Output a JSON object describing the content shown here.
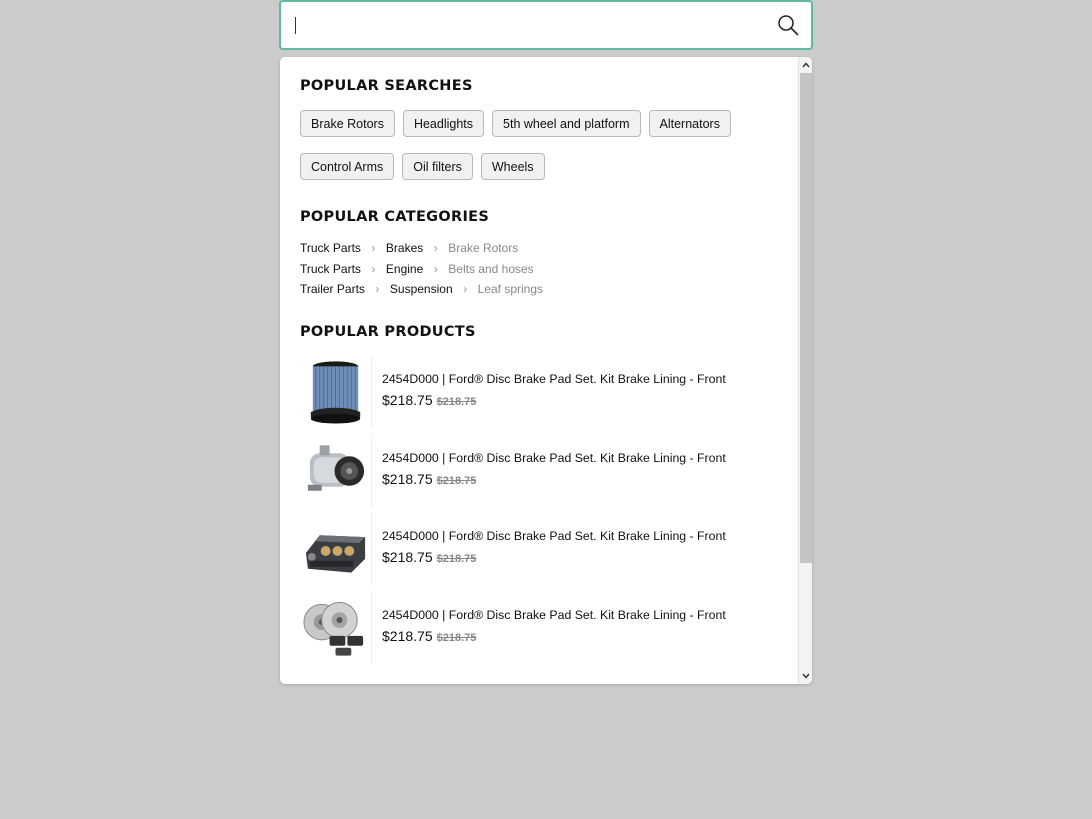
{
  "search": {
    "placeholder": "",
    "value": ""
  },
  "sections": {
    "searches_title": "POPULAR SEARCHES",
    "categories_title": "POPULAR CATEGORIES",
    "products_title": "POPULAR PRODUCTS"
  },
  "popular_searches": [
    "Brake Rotors",
    "Headlights",
    "5th wheel and platform",
    "Alternators",
    "Control Arms",
    "Oil filters",
    "Wheels"
  ],
  "categories": [
    [
      "Truck Parts",
      "Brakes",
      "Brake Rotors"
    ],
    [
      "Truck Parts",
      "Engine",
      "Belts and hoses"
    ],
    [
      "Trailer Parts",
      "Suspension",
      "Leaf springs"
    ]
  ],
  "products": [
    {
      "title": "2454D000 | Ford® Disc Brake Pad Set. Kit Brake Lining - Front",
      "price": "$218.75",
      "old_price": "$218.75",
      "image": "air-filter-image"
    },
    {
      "title": "2454D000 | Ford® Disc Brake Pad Set. Kit Brake Lining - Front",
      "price": "$218.75",
      "old_price": "$218.75",
      "image": "ac-compressor-image"
    },
    {
      "title": "2454D000 | Ford® Disc Brake Pad Set. Kit Brake Lining - Front",
      "price": "$218.75",
      "old_price": "$218.75",
      "image": "engine-block-image"
    },
    {
      "title": "2454D000 | Ford® Disc Brake Pad Set. Kit Brake Lining - Front",
      "price": "$218.75",
      "old_price": "$218.75",
      "image": "brake-rotors-image"
    }
  ],
  "colors": {
    "accent_border": "#5fb8a2",
    "background": "#cbcbcb"
  }
}
